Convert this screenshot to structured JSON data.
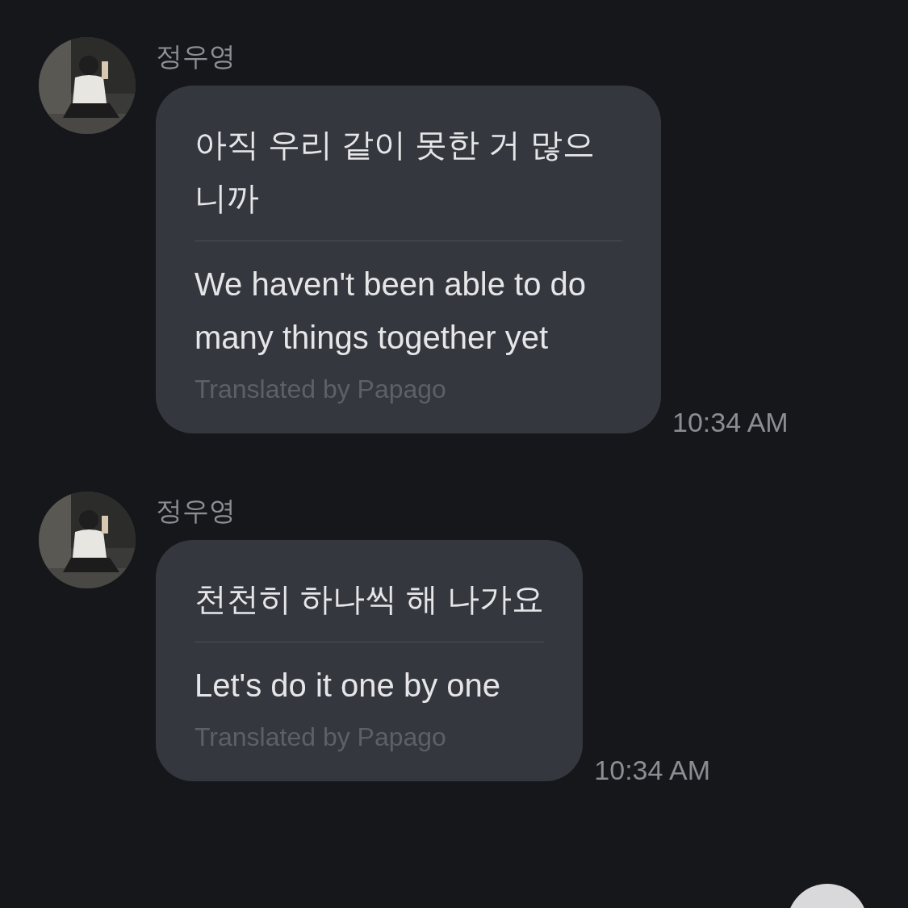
{
  "messages": [
    {
      "sender": "정우영",
      "original": "아직 우리 같이 못한 거 많으니까",
      "translation": "We haven't been able to do many things together yet",
      "credit": "Translated by Papago",
      "time": "10:34 AM"
    },
    {
      "sender": "정우영",
      "original": "천천히 하나씩 해 나가요",
      "translation": "Let's do it one by one",
      "credit": "Translated by Papago",
      "time": "10:34 AM"
    }
  ]
}
